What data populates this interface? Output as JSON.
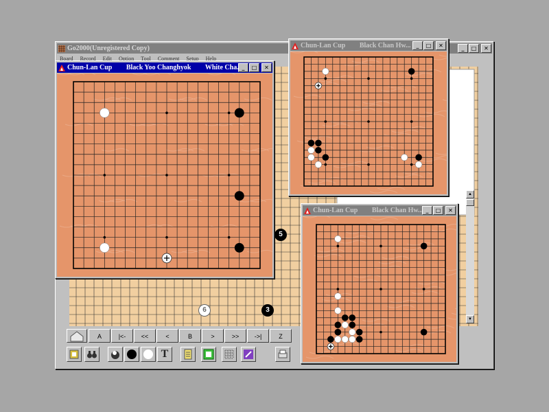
{
  "app": {
    "title": "Go2000(Unregistered Copy)",
    "menu": [
      "Board",
      "Record",
      "Edit",
      "Option",
      "Tool",
      "Comment",
      "Setup",
      "Help"
    ]
  },
  "main_window": {
    "title_parts": [
      "Chun-Lan Cup",
      "Black Yoo Changhyok",
      "White Cha..."
    ],
    "black_stones": [
      [
        3,
        13
      ],
      [
        8,
        14
      ],
      [
        13,
        13
      ],
      [
        16,
        14
      ]
    ],
    "white_stones": [
      [
        3,
        2
      ],
      [
        15,
        2
      ]
    ],
    "last_move": [
      15,
      7
    ],
    "star_points": true
  },
  "win2": {
    "title_parts": [
      "Chun-Lan Cup",
      "Black Chan Hw..."
    ],
    "black_stones": [
      [
        2,
        15
      ],
      [
        13,
        1
      ],
      [
        14,
        1
      ],
      [
        14,
        2
      ],
      [
        15,
        3
      ],
      [
        15,
        15
      ],
      [
        15,
        16
      ]
    ],
    "white_stones": [
      [
        2,
        3
      ],
      [
        13,
        2
      ],
      [
        14,
        2
      ],
      [
        15,
        2
      ],
      [
        16,
        3
      ],
      [
        15,
        14
      ],
      [
        16,
        16
      ]
    ],
    "last_move": [
      3,
      2
    ],
    "black_override": [
      [
        13,
        1
      ],
      [
        14,
        1
      ],
      [
        14,
        2
      ],
      [
        15,
        3
      ],
      [
        15,
        15
      ],
      [
        15,
        16
      ],
      [
        2,
        15
      ]
    ],
    "white_override": [
      [
        2,
        3
      ],
      [
        13,
        2
      ],
      [
        14,
        1
      ],
      [
        15,
        1
      ],
      [
        16,
        3
      ],
      [
        15,
        14
      ],
      [
        16,
        16
      ]
    ]
  },
  "win3": {
    "title_parts": [
      "Chun-Lan Cup",
      "Black Chan Hw..."
    ],
    "black_stones": [
      [
        3,
        15
      ],
      [
        13,
        3
      ],
      [
        14,
        4
      ],
      [
        15,
        3
      ],
      [
        15,
        4
      ],
      [
        16,
        2
      ],
      [
        17,
        2
      ],
      [
        14,
        5
      ],
      [
        15,
        6
      ],
      [
        16,
        6
      ],
      [
        16,
        5
      ],
      [
        15,
        15
      ],
      [
        14,
        4
      ]
    ],
    "white_stones": [
      [
        2,
        2
      ],
      [
        12,
        2
      ],
      [
        13,
        4
      ],
      [
        14,
        6
      ],
      [
        15,
        5
      ],
      [
        16,
        3
      ],
      [
        16,
        4
      ],
      [
        15,
        7
      ],
      [
        16,
        7
      ]
    ],
    "last_move": [
      17,
      2
    ]
  },
  "background_board": {
    "labels": [
      "5",
      "6",
      "3"
    ]
  },
  "nav_buttons": [
    "A",
    "|<-",
    "<<",
    "<",
    "B",
    ">",
    ">>",
    "->|",
    "Z"
  ],
  "tool_icons": [
    "sound-icon",
    "binoculars-icon",
    "bowl-icon",
    "black-stone-icon",
    "white-stone-icon",
    "text-tool-icon",
    "notepad-icon",
    "board-view-icon",
    "grid-icon",
    "pen-icon",
    "print-icon"
  ]
}
